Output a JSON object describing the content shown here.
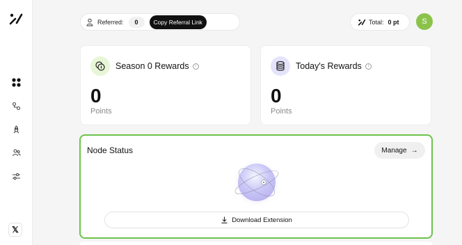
{
  "sidebar": {
    "logo_icon": "brand-slash-logo",
    "items": [
      {
        "icon": "grid-icon",
        "active": true
      },
      {
        "icon": "nodes-icon",
        "active": false
      },
      {
        "icon": "rocket-icon",
        "active": false
      },
      {
        "icon": "users-icon",
        "active": false
      },
      {
        "icon": "sliders-icon",
        "active": false
      }
    ],
    "social_label": "𝕏"
  },
  "header": {
    "referred_label": "Referred:",
    "referred_count": "0",
    "copy_referral_label": "Copy Referral Link",
    "total_label": "Total:",
    "total_value": "0 pt",
    "avatar_initial": "S",
    "avatar_color": "#8bc34a"
  },
  "rewards": [
    {
      "title": "Season 0 Rewards",
      "value": "0",
      "unit": "Points",
      "icon": "coins-icon"
    },
    {
      "title": "Today's Rewards",
      "value": "0",
      "unit": "Points",
      "icon": "database-icon"
    }
  ],
  "node": {
    "title": "Node Status",
    "manage_label": "Manage",
    "download_label": "Download Extension",
    "accent": "#6cc34c"
  }
}
